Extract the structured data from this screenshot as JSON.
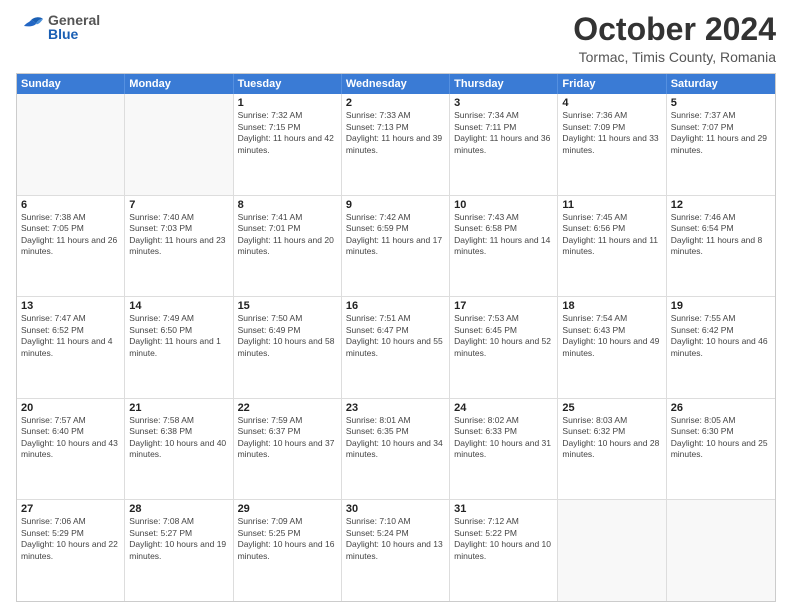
{
  "header": {
    "logo_general": "General",
    "logo_blue": "Blue",
    "month_title": "October 2024",
    "location": "Tormac, Timis County, Romania"
  },
  "weekdays": [
    "Sunday",
    "Monday",
    "Tuesday",
    "Wednesday",
    "Thursday",
    "Friday",
    "Saturday"
  ],
  "weeks": [
    [
      {
        "day": "",
        "sunrise": "",
        "sunset": "",
        "daylight": ""
      },
      {
        "day": "",
        "sunrise": "",
        "sunset": "",
        "daylight": ""
      },
      {
        "day": "1",
        "sunrise": "Sunrise: 7:32 AM",
        "sunset": "Sunset: 7:15 PM",
        "daylight": "Daylight: 11 hours and 42 minutes."
      },
      {
        "day": "2",
        "sunrise": "Sunrise: 7:33 AM",
        "sunset": "Sunset: 7:13 PM",
        "daylight": "Daylight: 11 hours and 39 minutes."
      },
      {
        "day": "3",
        "sunrise": "Sunrise: 7:34 AM",
        "sunset": "Sunset: 7:11 PM",
        "daylight": "Daylight: 11 hours and 36 minutes."
      },
      {
        "day": "4",
        "sunrise": "Sunrise: 7:36 AM",
        "sunset": "Sunset: 7:09 PM",
        "daylight": "Daylight: 11 hours and 33 minutes."
      },
      {
        "day": "5",
        "sunrise": "Sunrise: 7:37 AM",
        "sunset": "Sunset: 7:07 PM",
        "daylight": "Daylight: 11 hours and 29 minutes."
      }
    ],
    [
      {
        "day": "6",
        "sunrise": "Sunrise: 7:38 AM",
        "sunset": "Sunset: 7:05 PM",
        "daylight": "Daylight: 11 hours and 26 minutes."
      },
      {
        "day": "7",
        "sunrise": "Sunrise: 7:40 AM",
        "sunset": "Sunset: 7:03 PM",
        "daylight": "Daylight: 11 hours and 23 minutes."
      },
      {
        "day": "8",
        "sunrise": "Sunrise: 7:41 AM",
        "sunset": "Sunset: 7:01 PM",
        "daylight": "Daylight: 11 hours and 20 minutes."
      },
      {
        "day": "9",
        "sunrise": "Sunrise: 7:42 AM",
        "sunset": "Sunset: 6:59 PM",
        "daylight": "Daylight: 11 hours and 17 minutes."
      },
      {
        "day": "10",
        "sunrise": "Sunrise: 7:43 AM",
        "sunset": "Sunset: 6:58 PM",
        "daylight": "Daylight: 11 hours and 14 minutes."
      },
      {
        "day": "11",
        "sunrise": "Sunrise: 7:45 AM",
        "sunset": "Sunset: 6:56 PM",
        "daylight": "Daylight: 11 hours and 11 minutes."
      },
      {
        "day": "12",
        "sunrise": "Sunrise: 7:46 AM",
        "sunset": "Sunset: 6:54 PM",
        "daylight": "Daylight: 11 hours and 8 minutes."
      }
    ],
    [
      {
        "day": "13",
        "sunrise": "Sunrise: 7:47 AM",
        "sunset": "Sunset: 6:52 PM",
        "daylight": "Daylight: 11 hours and 4 minutes."
      },
      {
        "day": "14",
        "sunrise": "Sunrise: 7:49 AM",
        "sunset": "Sunset: 6:50 PM",
        "daylight": "Daylight: 11 hours and 1 minute."
      },
      {
        "day": "15",
        "sunrise": "Sunrise: 7:50 AM",
        "sunset": "Sunset: 6:49 PM",
        "daylight": "Daylight: 10 hours and 58 minutes."
      },
      {
        "day": "16",
        "sunrise": "Sunrise: 7:51 AM",
        "sunset": "Sunset: 6:47 PM",
        "daylight": "Daylight: 10 hours and 55 minutes."
      },
      {
        "day": "17",
        "sunrise": "Sunrise: 7:53 AM",
        "sunset": "Sunset: 6:45 PM",
        "daylight": "Daylight: 10 hours and 52 minutes."
      },
      {
        "day": "18",
        "sunrise": "Sunrise: 7:54 AM",
        "sunset": "Sunset: 6:43 PM",
        "daylight": "Daylight: 10 hours and 49 minutes."
      },
      {
        "day": "19",
        "sunrise": "Sunrise: 7:55 AM",
        "sunset": "Sunset: 6:42 PM",
        "daylight": "Daylight: 10 hours and 46 minutes."
      }
    ],
    [
      {
        "day": "20",
        "sunrise": "Sunrise: 7:57 AM",
        "sunset": "Sunset: 6:40 PM",
        "daylight": "Daylight: 10 hours and 43 minutes."
      },
      {
        "day": "21",
        "sunrise": "Sunrise: 7:58 AM",
        "sunset": "Sunset: 6:38 PM",
        "daylight": "Daylight: 10 hours and 40 minutes."
      },
      {
        "day": "22",
        "sunrise": "Sunrise: 7:59 AM",
        "sunset": "Sunset: 6:37 PM",
        "daylight": "Daylight: 10 hours and 37 minutes."
      },
      {
        "day": "23",
        "sunrise": "Sunrise: 8:01 AM",
        "sunset": "Sunset: 6:35 PM",
        "daylight": "Daylight: 10 hours and 34 minutes."
      },
      {
        "day": "24",
        "sunrise": "Sunrise: 8:02 AM",
        "sunset": "Sunset: 6:33 PM",
        "daylight": "Daylight: 10 hours and 31 minutes."
      },
      {
        "day": "25",
        "sunrise": "Sunrise: 8:03 AM",
        "sunset": "Sunset: 6:32 PM",
        "daylight": "Daylight: 10 hours and 28 minutes."
      },
      {
        "day": "26",
        "sunrise": "Sunrise: 8:05 AM",
        "sunset": "Sunset: 6:30 PM",
        "daylight": "Daylight: 10 hours and 25 minutes."
      }
    ],
    [
      {
        "day": "27",
        "sunrise": "Sunrise: 7:06 AM",
        "sunset": "Sunset: 5:29 PM",
        "daylight": "Daylight: 10 hours and 22 minutes."
      },
      {
        "day": "28",
        "sunrise": "Sunrise: 7:08 AM",
        "sunset": "Sunset: 5:27 PM",
        "daylight": "Daylight: 10 hours and 19 minutes."
      },
      {
        "day": "29",
        "sunrise": "Sunrise: 7:09 AM",
        "sunset": "Sunset: 5:25 PM",
        "daylight": "Daylight: 10 hours and 16 minutes."
      },
      {
        "day": "30",
        "sunrise": "Sunrise: 7:10 AM",
        "sunset": "Sunset: 5:24 PM",
        "daylight": "Daylight: 10 hours and 13 minutes."
      },
      {
        "day": "31",
        "sunrise": "Sunrise: 7:12 AM",
        "sunset": "Sunset: 5:22 PM",
        "daylight": "Daylight: 10 hours and 10 minutes."
      },
      {
        "day": "",
        "sunrise": "",
        "sunset": "",
        "daylight": ""
      },
      {
        "day": "",
        "sunrise": "",
        "sunset": "",
        "daylight": ""
      }
    ]
  ]
}
